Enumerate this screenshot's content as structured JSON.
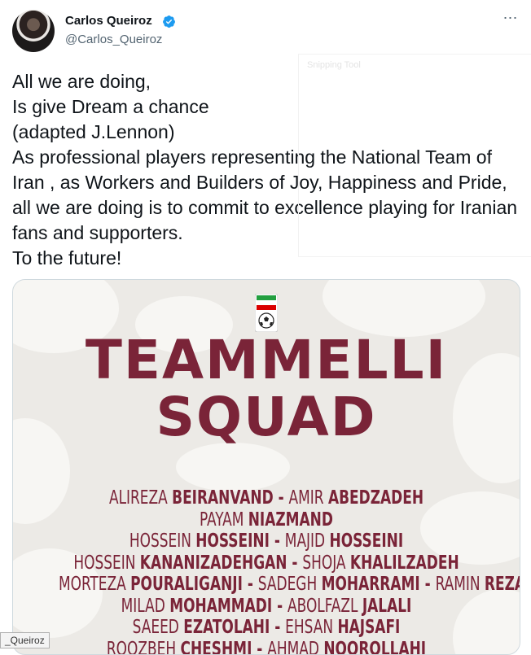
{
  "author": {
    "name": "Carlos Queiroz",
    "handle": "@Carlos_Queiroz",
    "verified": true
  },
  "icons": {
    "avatar": "profile-photo",
    "verified": "verified-badge-icon",
    "more": "more-horizontal-icon"
  },
  "tweet": {
    "text": "All we are doing,\nIs give Dream a chance\n(adapted J.Lennon)\nAs professional players representing the National Team of Iran , as Workers and Builders of Joy, Happiness and Pride, all we are doing is to commit to excellence playing for Iranian fans and supporters.\nTo the future!"
  },
  "snip_overlay": {
    "label": "Snipping Tool"
  },
  "media": {
    "title_line1": "TEAMMELLI",
    "title_line2": "SQUAD",
    "roster": [
      [
        [
          "ALIREZA ",
          "BEIRANVAND"
        ],
        [
          "AMIR ",
          "ABEDZADEH"
        ]
      ],
      [
        [
          "PAYAM ",
          "NIAZMAND"
        ]
      ],
      [
        [
          "HOSSEIN ",
          "HOSSEINI"
        ],
        [
          "MAJID ",
          "HOSSEINI"
        ]
      ],
      [
        [
          "HOSSEIN ",
          "KANANIZADEHGAN"
        ],
        [
          "SHOJA ",
          "KHALILZADEH"
        ]
      ],
      [
        [
          "MORTEZA ",
          "POURALIGANJI"
        ],
        [
          "SADEGH ",
          "MOHARRAMI"
        ],
        [
          "RAMIN ",
          "REZAEIAN"
        ]
      ],
      [
        [
          "MILAD ",
          "MOHAMMADI"
        ],
        [
          "ABOLFAZL ",
          "JALALI"
        ]
      ],
      [
        [
          "SAEED ",
          "EZATOLAHI"
        ],
        [
          "EHSAN ",
          "HAJSAFI"
        ]
      ],
      [
        [
          "ROOZBEH ",
          "CHESHMI"
        ],
        [
          "AHMAD ",
          "NOOROLLAHI"
        ]
      ]
    ],
    "colors": {
      "brand": "#7a2438",
      "background": "#eceae6"
    }
  },
  "tooltip": {
    "text": "_Queiroz"
  },
  "colors": {
    "verified": "#1d9bf0",
    "muted": "#536471",
    "text": "#0f1419"
  }
}
